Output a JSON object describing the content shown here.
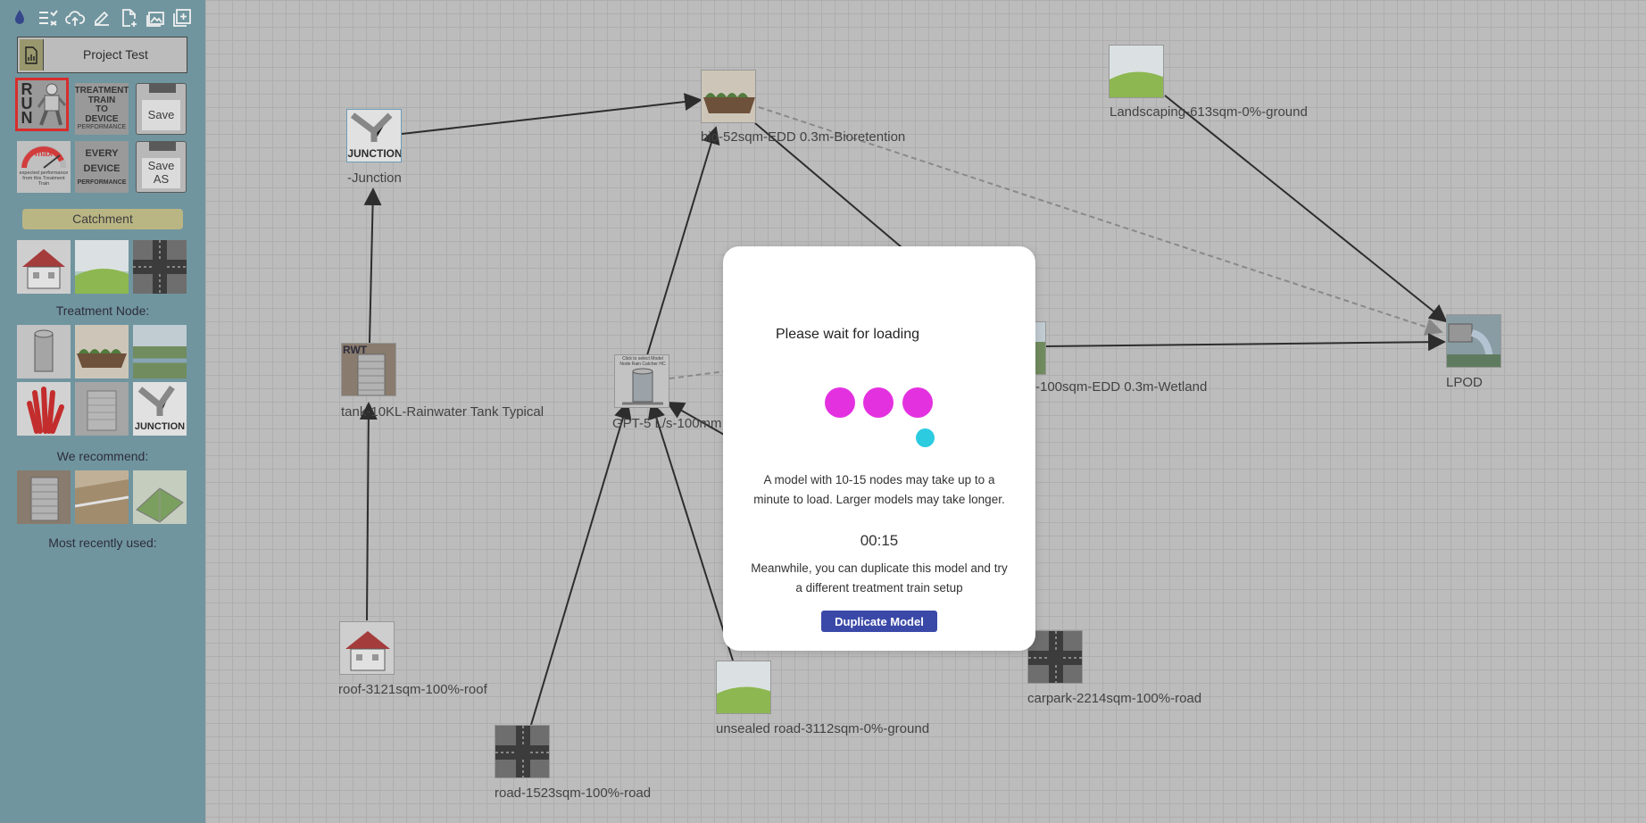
{
  "toolbar": {
    "icons": [
      "water-drop-icon",
      "checklist-icon",
      "cloud-upload-icon",
      "edit-icon",
      "new-file-icon",
      "image-icon",
      "add-box-icon"
    ]
  },
  "project": {
    "label": "Project Test"
  },
  "actions": {
    "run": "RUN",
    "treatment_train_perf": [
      "TREATMENT",
      "TRAIN",
      "TO",
      "DEVICE",
      "PERFORMANCE"
    ],
    "save": "Save",
    "max_perf": {
      "max": "max",
      "caption": "expected performance from this Treatment Train"
    },
    "every_device_perf": [
      "EVERY",
      "DEVICE",
      "PERFORMANCE"
    ],
    "save_as": [
      "Save",
      "AS"
    ]
  },
  "sidebar": {
    "catchment_btn": "Catchment",
    "treatment_title": "Treatment Node:",
    "junction_tile": "JUNCTION",
    "recommend_title": "We recommend:",
    "recent_title": "Most recently used:"
  },
  "nodes": {
    "junction": {
      "label": "-Junction",
      "img_text": "JUNCTION"
    },
    "bio": {
      "label": "bio-52sqm-EDD 0.3m-Bioretention"
    },
    "landscaping": {
      "label": "Landscaping-613sqm-0%-ground"
    },
    "lpod": {
      "label": "LPOD"
    },
    "tank": {
      "label": "tank-10KL-Rainwater Tank Typical",
      "img_text": "RWT"
    },
    "gpt": {
      "label": "GPT-5 L/s-100mm",
      "img_text": "Click to select Model Node Rain Catcher HC"
    },
    "wetland": {
      "label": "-100sqm-EDD 0.3m-Wetland"
    },
    "roof": {
      "label": "roof-3121sqm-100%-roof"
    },
    "road": {
      "label": "road-1523sqm-100%-road"
    },
    "unsealed": {
      "label": "unsealed road-3112sqm-0%-ground"
    },
    "carpark": {
      "label": "carpark-2214sqm-100%-road"
    }
  },
  "modal": {
    "title": "Please wait for loading",
    "description": "A model with 10-15 nodes may take up to a minute to load. Larger models may take longer.",
    "timer": "00:15",
    "hint": "Meanwhile, you can duplicate this model and try a different treatment train setup",
    "button": "Duplicate Model",
    "colors": {
      "dot_primary": "#e431e0",
      "dot_secondary": "#2ccbe0",
      "button": "#3a49a8"
    }
  }
}
